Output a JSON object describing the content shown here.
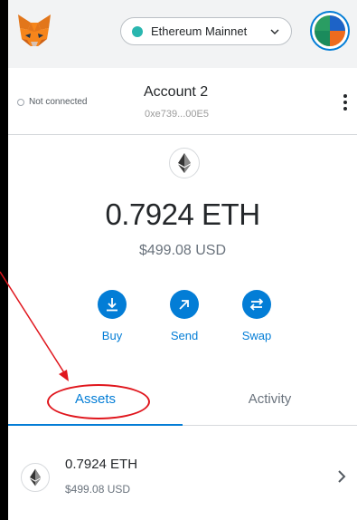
{
  "header": {
    "network": "Ethereum Mainnet",
    "network_dot_color": "#29b6af",
    "logo_icon": "metamask-fox-icon",
    "avatar_icon": "account-avatar-icon"
  },
  "account": {
    "connection_status": "Not connected",
    "name": "Account 2",
    "address": "0xe739...00E5",
    "menu_icon": "kebab-menu-icon"
  },
  "balance": {
    "token_icon": "ethereum-icon",
    "amount": "0.7924 ETH",
    "usd": "$499.08 USD"
  },
  "actions": [
    {
      "label": "Buy",
      "icon": "download-icon"
    },
    {
      "label": "Send",
      "icon": "arrow-up-right-icon"
    },
    {
      "label": "Swap",
      "icon": "swap-icon"
    }
  ],
  "tabs": [
    {
      "label": "Assets",
      "active": true
    },
    {
      "label": "Activity",
      "active": false
    }
  ],
  "assets": [
    {
      "amount": "0.7924 ETH",
      "usd": "$499.08 USD",
      "icon": "ethereum-icon"
    }
  ],
  "colors": {
    "accent": "#037dd6",
    "annotation": "#e0161d"
  }
}
